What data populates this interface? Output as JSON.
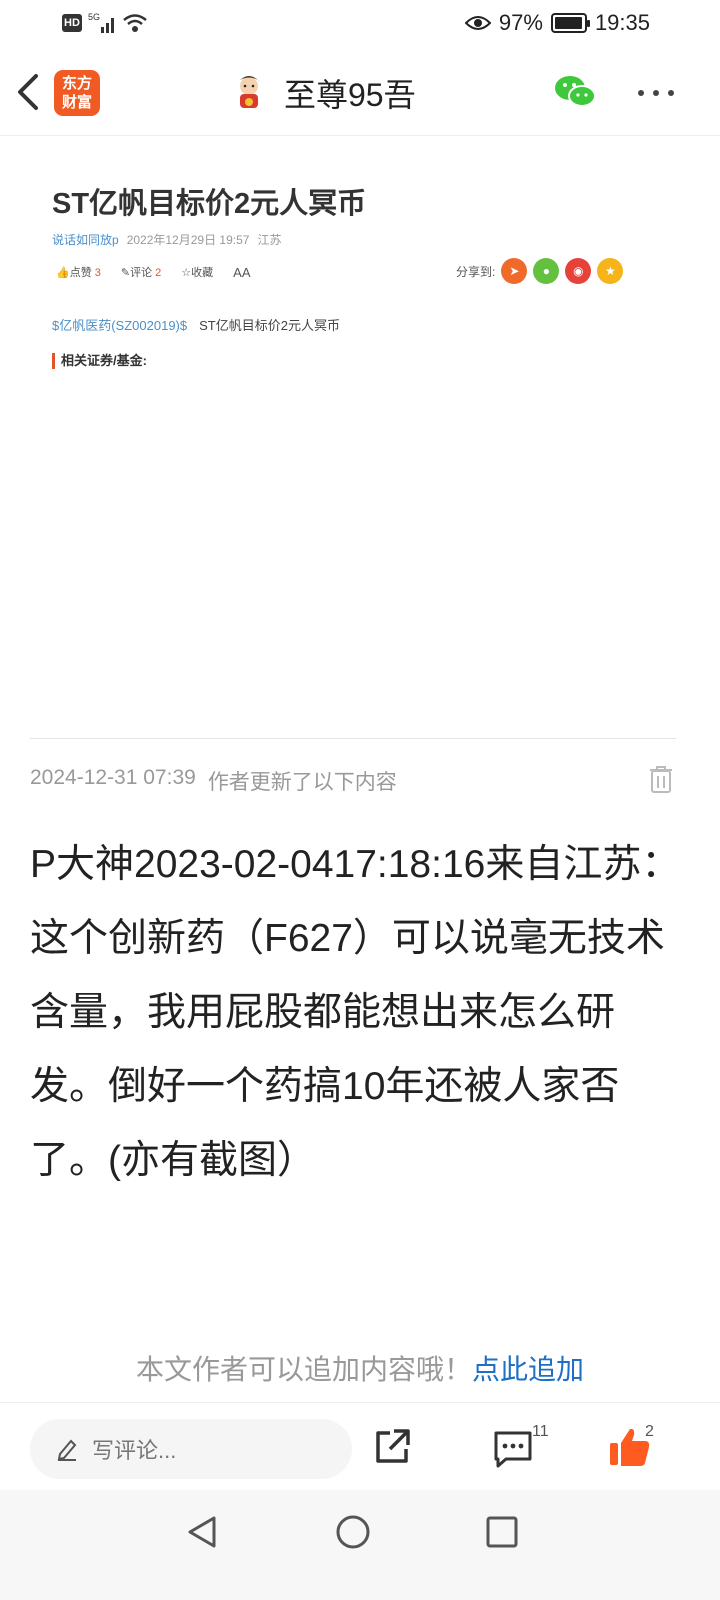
{
  "status_bar": {
    "hd": "HD",
    "network": "5G",
    "battery_percent": "97%",
    "battery_level": 0.97,
    "time": "19:35"
  },
  "header": {
    "logo_line1": "东方",
    "logo_line2": "财富",
    "author_name": "至尊95吾"
  },
  "article": {
    "title": "ST亿帆目标价2元人冥币",
    "author": "说话如同放p",
    "date": "2022年12月29日 19:57",
    "location": "江苏",
    "like_label": "点赞",
    "like_count": "3",
    "comment_label": "评论",
    "comment_count": "2",
    "collect_label": "收藏",
    "font_label": "AA",
    "share_label": "分享到:",
    "stock_tag": "$亿帆医药(SZ002019)$",
    "body": "ST亿帆目标价2元人冥币",
    "related_label": "相关证券/基金:"
  },
  "update": {
    "timestamp": "2024-12-31 07:39",
    "label": "作者更新了以下内容",
    "content": "P大神2023-02-0417:18:16来自江苏：这个创新药（F627）可以说毫无技术含量，我用屁股都能想出来怎么研发。倒好一个药搞10年还被人家否了。(亦有截图）"
  },
  "append": {
    "prompt": "本文作者可以追加内容哦！",
    "link": "点此追加"
  },
  "bottom_bar": {
    "comment_placeholder": "写评论...",
    "comment_count": "11",
    "like_count": "2"
  },
  "colors": {
    "accent": "#f15a22",
    "link": "#1f6fc5",
    "like": "#ff5a1f"
  }
}
